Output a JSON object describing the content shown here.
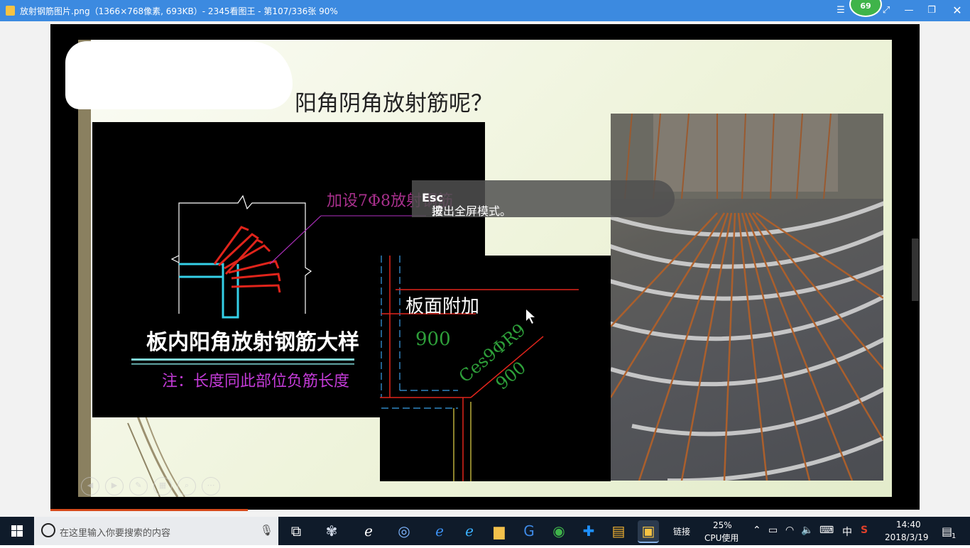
{
  "window": {
    "title": "放射钢筋图片.png（1366×768像素, 693KB）- 2345看图王 - 第107/336张 90%",
    "badge": "69"
  },
  "slide": {
    "title": "阳角阴角放射筋呢？",
    "cad_note_top": "加设7Φ8放射钢筋",
    "cad_caption": "板内阳角放射钢筋大样",
    "cad_note": "注：长度同此部位负筋长度",
    "cad2_label": "板面附加",
    "cad2_dim1": "900",
    "cad2_dim2": "Ces9ΦR9",
    "cad2_dim3": "900"
  },
  "esc_hint": {
    "prefix": "按",
    "key": "Esc",
    "suffix": "退出全屏模式。"
  },
  "taskbar": {
    "search_placeholder": "在这里输入你要搜索的内容",
    "link_label": "链接",
    "cpu_percent": "25%",
    "cpu_label": "CPU使用",
    "ime_label": "中",
    "time": "14:40",
    "date": "2018/3/19",
    "notif_count": "1"
  },
  "colors": {
    "titlebar": "#3c8ae0",
    "taskbar": "#0f1b2a",
    "slide_bg": "#eef3da",
    "rebar_red": "#e0241b",
    "rebar_cyan": "#35d0e8",
    "note_magenta": "#c43bd8"
  }
}
